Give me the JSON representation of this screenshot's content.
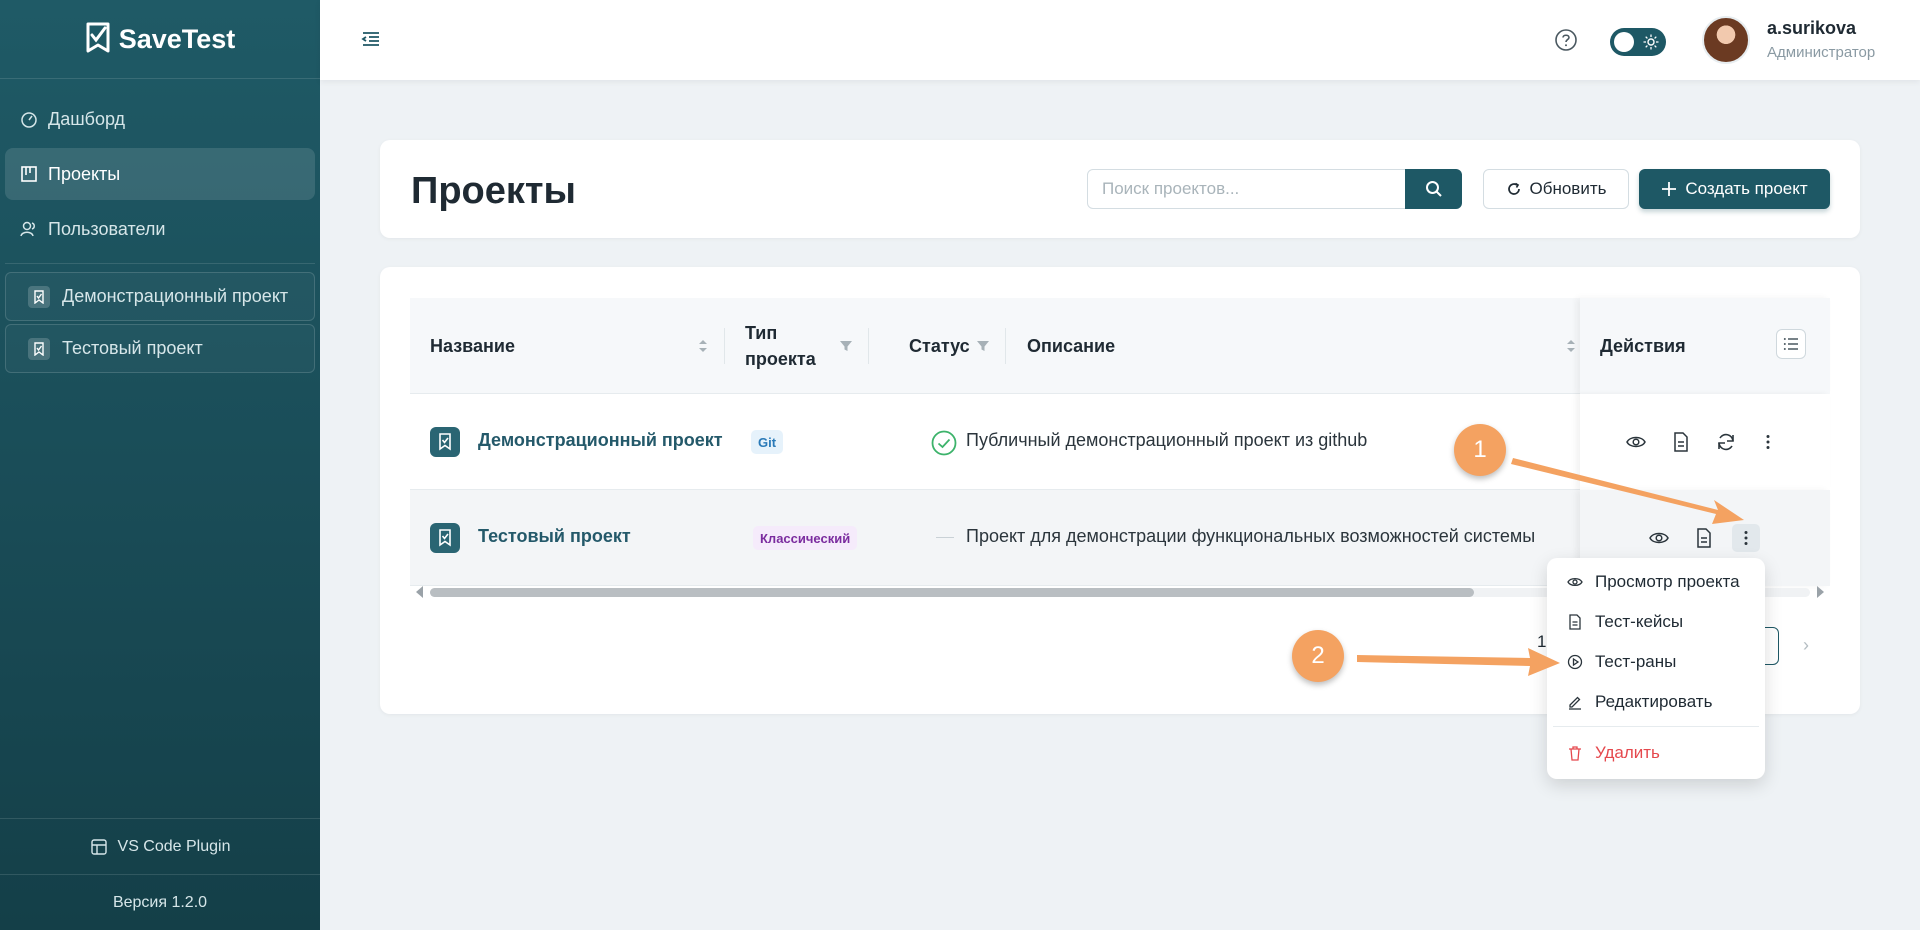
{
  "brand": {
    "name": "SaveTest"
  },
  "sidebar": {
    "items": [
      {
        "label": "Дашборд",
        "icon": "dashboard-icon"
      },
      {
        "label": "Проекты",
        "icon": "projects-icon"
      },
      {
        "label": "Пользователи",
        "icon": "users-icon"
      }
    ],
    "projects": [
      {
        "label": "Демонстрационный проект"
      },
      {
        "label": "Тестовый проект"
      }
    ],
    "plugin_label": "VS Code Plugin",
    "version_label": "Версия 1.2.0"
  },
  "header": {
    "user_name": "a.surikova",
    "user_role": "Администратор"
  },
  "page": {
    "title": "Проекты",
    "search_placeholder": "Поиск проектов...",
    "refresh_label": "Обновить",
    "create_label": "Создать проект"
  },
  "table": {
    "columns": {
      "name": "Название",
      "type": "Тип проекта",
      "status": "Статус",
      "description": "Описание",
      "actions": "Действия"
    },
    "rows": [
      {
        "name": "Демонстрационный проект",
        "type": "Git",
        "status": "ok",
        "description": "Публичный демонстрационный проект из github"
      },
      {
        "name": "Тестовый проект",
        "type": "Классический",
        "status": "—",
        "description": "Проект для демонстрации функциональных возможностей системы"
      }
    ]
  },
  "pagination": {
    "current": "1"
  },
  "dropdown": {
    "items": [
      {
        "label": "Просмотр проекта",
        "icon": "eye-icon"
      },
      {
        "label": "Тест-кейсы",
        "icon": "document-icon"
      },
      {
        "label": "Тест-раны",
        "icon": "play-circle-icon"
      },
      {
        "label": "Редактировать",
        "icon": "edit-icon"
      }
    ],
    "delete_label": "Удалить"
  },
  "callouts": {
    "first": "1",
    "second": "2"
  },
  "colors": {
    "accent": "#1e5865",
    "callout": "#f4a261",
    "danger": "#e5484d"
  }
}
